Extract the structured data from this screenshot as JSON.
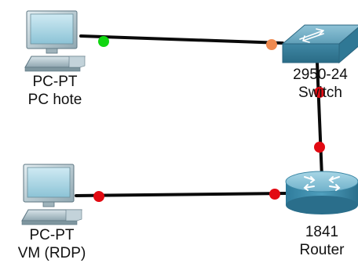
{
  "devices": [
    {
      "id": "pc-hote",
      "model": "PC-PT",
      "name": "PC hote",
      "kind": "pc"
    },
    {
      "id": "switch",
      "model": "2950-24",
      "name": "Switch",
      "kind": "switch"
    },
    {
      "id": "router",
      "model": "1841",
      "name": "Router",
      "kind": "router"
    },
    {
      "id": "vm-rdp",
      "model": "PC-PT",
      "name": "VM (RDP)",
      "kind": "pc"
    }
  ],
  "links": [
    {
      "from": "pc-hote",
      "to": "switch",
      "from_status": "up",
      "to_status": "negotiating"
    },
    {
      "from": "switch",
      "to": "router",
      "from_status": "down",
      "to_status": "down"
    },
    {
      "from": "vm-rdp",
      "to": "router",
      "from_status": "down",
      "to_status": "down"
    }
  ],
  "status_colors": {
    "up": "#11d611",
    "negotiating": "#ef8a50",
    "down": "#e20a12"
  },
  "cable_color": "#0a0a0a"
}
